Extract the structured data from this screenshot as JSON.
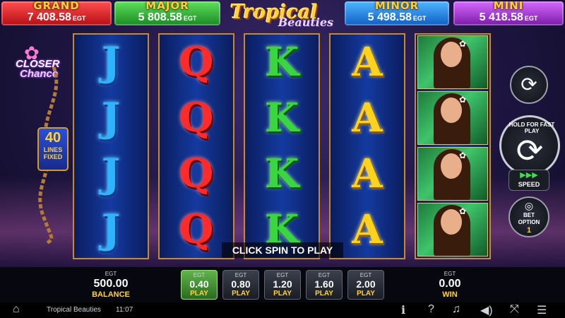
{
  "jackpots": {
    "grand": {
      "title": "GRAND",
      "value": "7 408.58",
      "unit": "EGT"
    },
    "major": {
      "title": "MAJOR",
      "value": "5 808.58",
      "unit": "EGT"
    },
    "minor": {
      "title": "MINOR",
      "value": "5 498.58",
      "unit": "EGT"
    },
    "mini": {
      "title": "MINI",
      "value": "5 418.58",
      "unit": "EGT"
    }
  },
  "logo": {
    "line1": "Tropical",
    "line2": "Beauties"
  },
  "closer_chance": {
    "line1": "CLOSER",
    "line2": "Chance"
  },
  "lines": {
    "count": "40",
    "label1": "LINES",
    "label2": "FIXED"
  },
  "reels": [
    [
      "J",
      "J",
      "J",
      "J"
    ],
    [
      "Q",
      "Q",
      "Q",
      "Q"
    ],
    [
      "K",
      "K",
      "K",
      "K"
    ],
    [
      "A",
      "A",
      "A",
      "A"
    ],
    [
      "WILD",
      "WILD",
      "WILD",
      "WILD"
    ]
  ],
  "message": "CLICK SPIN TO PLAY",
  "controls": {
    "spin_hint": "HOLD FOR FAST PLAY",
    "speed_label": "SPEED",
    "bet_option_label1": "BET",
    "bet_option_label2": "OPTION",
    "bet_option_value": "1"
  },
  "balance": {
    "unit": "EGT",
    "value": "500.00",
    "label": "BALANCE"
  },
  "win": {
    "unit": "EGT",
    "value": "0.00",
    "label": "WIN"
  },
  "bets": [
    {
      "unit": "EGT",
      "value": "0.40",
      "label": "PLAY",
      "selected": true
    },
    {
      "unit": "EGT",
      "value": "0.80",
      "label": "PLAY"
    },
    {
      "unit": "EGT",
      "value": "1.20",
      "label": "PLAY"
    },
    {
      "unit": "EGT",
      "value": "1.60",
      "label": "PLAY"
    },
    {
      "unit": "EGT",
      "value": "2.00",
      "label": "PLAY"
    }
  ],
  "status_bar": {
    "title": "Tropical Beauties",
    "time": "11:07"
  },
  "icons": [
    "home-icon",
    "info-icon",
    "help-icon",
    "music-icon",
    "sound-icon",
    "fullscreen-icon",
    "menu-icon",
    "autoplay-icon",
    "spin-icon",
    "coins-icon"
  ]
}
